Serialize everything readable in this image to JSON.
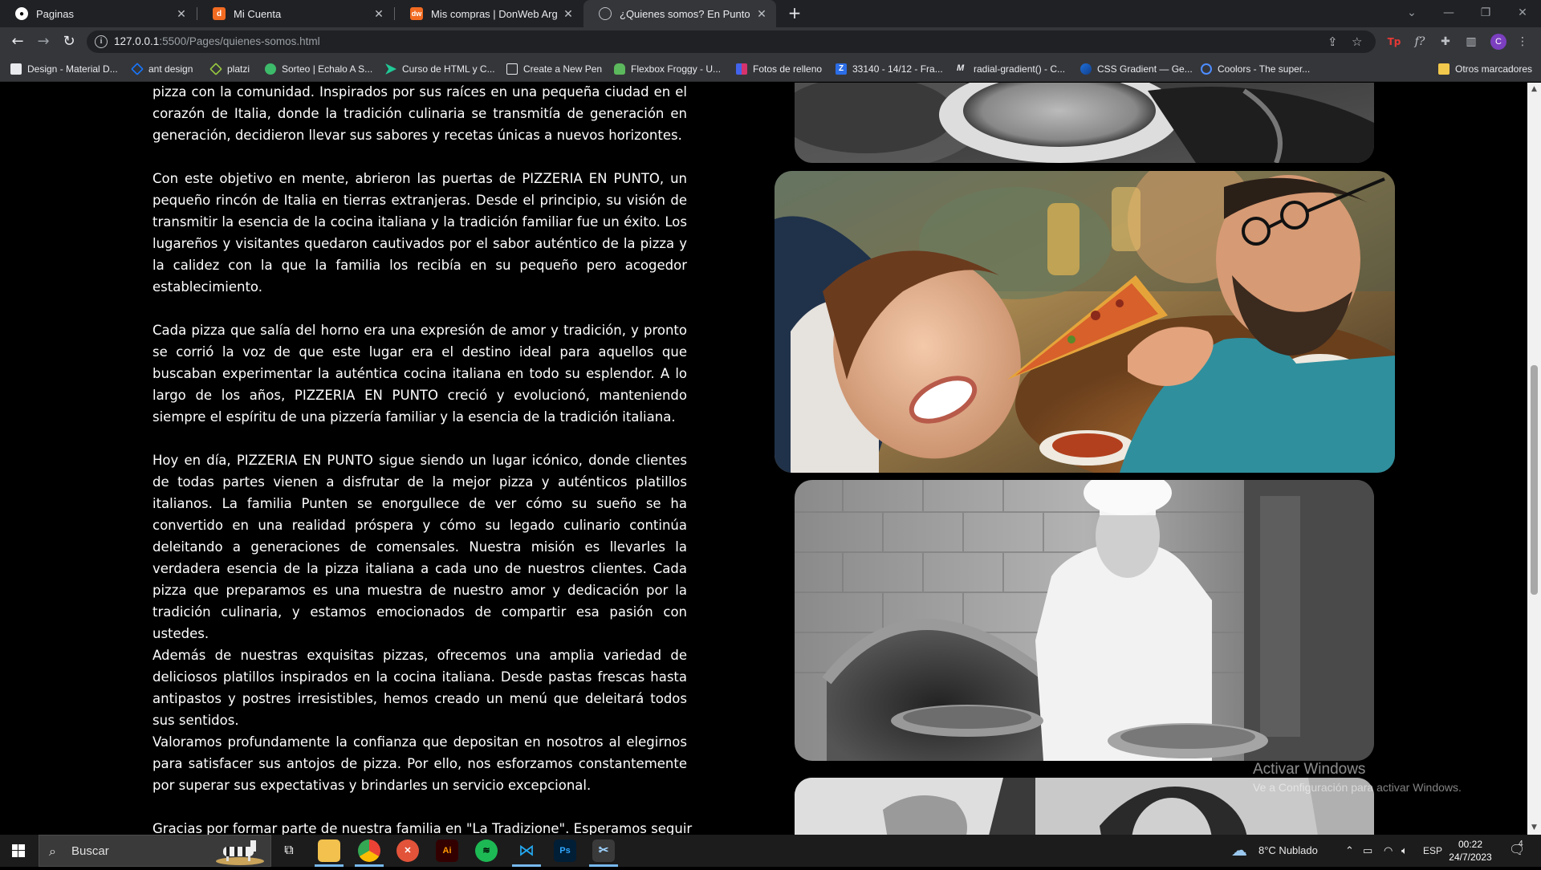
{
  "browser": {
    "tabs": [
      {
        "title": "Paginas",
        "icon": "github-icon",
        "active": false
      },
      {
        "title": "Mi Cuenta",
        "icon": "donweb-icon",
        "active": false
      },
      {
        "title": "Mis compras | DonWeb Argentina",
        "icon": "donweb-dw-icon",
        "active": false
      },
      {
        "title": "¿Quienes somos? En Punto Pizzeria",
        "icon": "globe-icon",
        "active": true
      }
    ],
    "new_tab_label": "+",
    "url_host": "127.0.0.1",
    "url_rest": ":5500/Pages/quienes-somos.html",
    "bookmarks": [
      {
        "label": "Design - Material D...",
        "color": "#f4b400"
      },
      {
        "label": "ant design",
        "color": "#1677ff"
      },
      {
        "label": "platzi",
        "color": "#98ca3f"
      },
      {
        "label": "Sorteo | Echalo A S...",
        "color": "#3dbb6a"
      },
      {
        "label": "Curso de HTML y C...",
        "color": "#20c997"
      },
      {
        "label": "Create a New Pen",
        "color": "#e8eaed"
      },
      {
        "label": "Flexbox Froggy - U...",
        "color": "#5cb85c"
      },
      {
        "label": "Fotos de relleno",
        "color": "#d6336c"
      },
      {
        "label": "33140 - 14/12 - Fra...",
        "color": "#2b6de6"
      },
      {
        "label": "radial-gradient() - C...",
        "color": "#e8eaed"
      },
      {
        "label": "CSS Gradient — Ge...",
        "color": "#1e6fd9"
      },
      {
        "label": "Coolors - The super...",
        "color": "#0066ff"
      }
    ],
    "other_bookmarks": "Otros marcadores"
  },
  "page": {
    "paragraphs": [
      "pizza con la comunidad. Inspirados por sus raíces en una pequeña ciudad en el corazón de Italia, donde la tradición culinaria se transmitía de generación en generación, decidieron llevar sus sabores y recetas únicas a nuevos horizontes.",
      "Con este objetivo en mente, abrieron las puertas de PIZZERIA EN PUNTO, un pequeño rincón de Italia en tierras extranjeras. Desde el principio, su visión de transmitir la esencia de la cocina italiana y la tradición familiar fue un éxito. Los lugareños y visitantes quedaron cautivados por el sabor auténtico de la pizza y la calidez con la que la familia los recibía en su pequeño pero acogedor establecimiento.",
      "Cada pizza que salía del horno era una expresión de amor y tradición, y pronto se corrió la voz de que este lugar era el destino ideal para aquellos que buscaban experimentar la auténtica cocina italiana en todo su esplendor. A lo largo de los años, PIZZERIA EN PUNTO creció y evolucionó, manteniendo siempre el espíritu de una pizzería familiar y la esencia de la tradición italiana.",
      "Hoy en día, PIZZERIA EN PUNTO sigue siendo un lugar icónico, donde clientes de todas partes vienen a disfrutar de la mejor pizza y auténticos platillos italianos. La familia Punten se enorgullece de ver cómo su sueño se ha convertido en una realidad próspera y cómo su legado culinario continúa deleitando a generaciones de comensales. Nuestra misión es llevarles la verdadera esencia de la pizza italiana a cada uno de nuestros clientes. Cada pizza que preparamos es una muestra de nuestro amor y dedicación por la tradición culinaria, y estamos emocionados de compartir esa pasión con ustedes.",
      "Además de nuestras exquisitas pizzas, ofrecemos una amplia variedad de deliciosos platillos inspirados en la cocina italiana. Desde pastas frescas hasta antipastos y postres irresistibles, hemos creado un menú que deleitará todos sus sentidos.",
      "Valoramos profundamente la confianza que depositan en nosotros al elegirnos para satisfacer sus antojos de pizza. Por ello, nos esforzamos constantemente por superar sus expectativas y brindarles un servicio excepcional.",
      "Gracias por formar parte de nuestra familia en \"La Tradizione\". Esperamos seguir"
    ],
    "photos": [
      {
        "name": "photo-pizza-plates-bw"
      },
      {
        "name": "photo-couple-sharing-pizza"
      },
      {
        "name": "photo-chef-with-pizzas-bw"
      },
      {
        "name": "photo-women-eating-bw"
      }
    ]
  },
  "watermark": {
    "title": "Activar Windows",
    "subtitle": "Ve a Configuración para activar Windows."
  },
  "taskbar": {
    "search_placeholder": "Buscar",
    "weather": "8°C  Nublado",
    "language": "ESP",
    "time": "00:22",
    "date": "24/7/2023",
    "notification_count": "4"
  }
}
